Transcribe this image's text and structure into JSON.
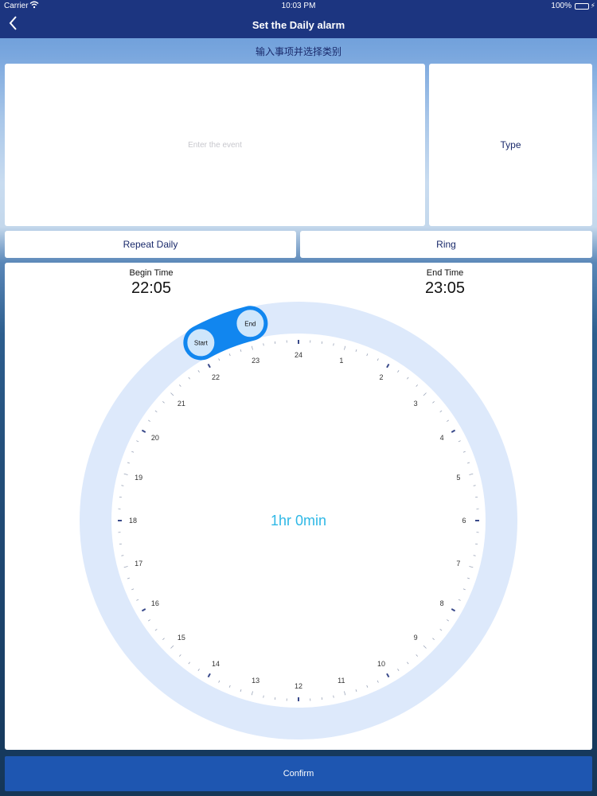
{
  "status_bar": {
    "carrier": "Carrier",
    "time": "10:03 PM",
    "battery_percent": "100%",
    "battery_level": 1.0
  },
  "nav": {
    "title": "Set the Daily alarm",
    "back_icon": "chevron-left-icon"
  },
  "hint": "输入事项并选择类别",
  "event_input": {
    "placeholder": "Enter the event",
    "value": ""
  },
  "type_button": "Type",
  "repeat_button": "Repeat Daily",
  "ring_button": "Ring",
  "begin_time": {
    "label": "Begin Time",
    "value": "22:05"
  },
  "end_time": {
    "label": "End Time",
    "value": "23:05"
  },
  "clock": {
    "hour_labels": [
      "24",
      "1",
      "2",
      "3",
      "4",
      "5",
      "6",
      "7",
      "8",
      "9",
      "10",
      "11",
      "12",
      "13",
      "14",
      "15",
      "16",
      "17",
      "18",
      "19",
      "20",
      "21",
      "22",
      "23"
    ],
    "duration": "1hr 0min",
    "start_handle": "Start",
    "end_handle": "End",
    "start_hour": 22.0833,
    "end_hour": 23.0833
  },
  "confirm_button": "Confirm",
  "colors": {
    "nav_bg": "#1c3580",
    "ring_track": "#dde9fb",
    "arc": "#1186ef",
    "duration_text": "#2fb8e6",
    "confirm_bg": "#1e56b1"
  }
}
